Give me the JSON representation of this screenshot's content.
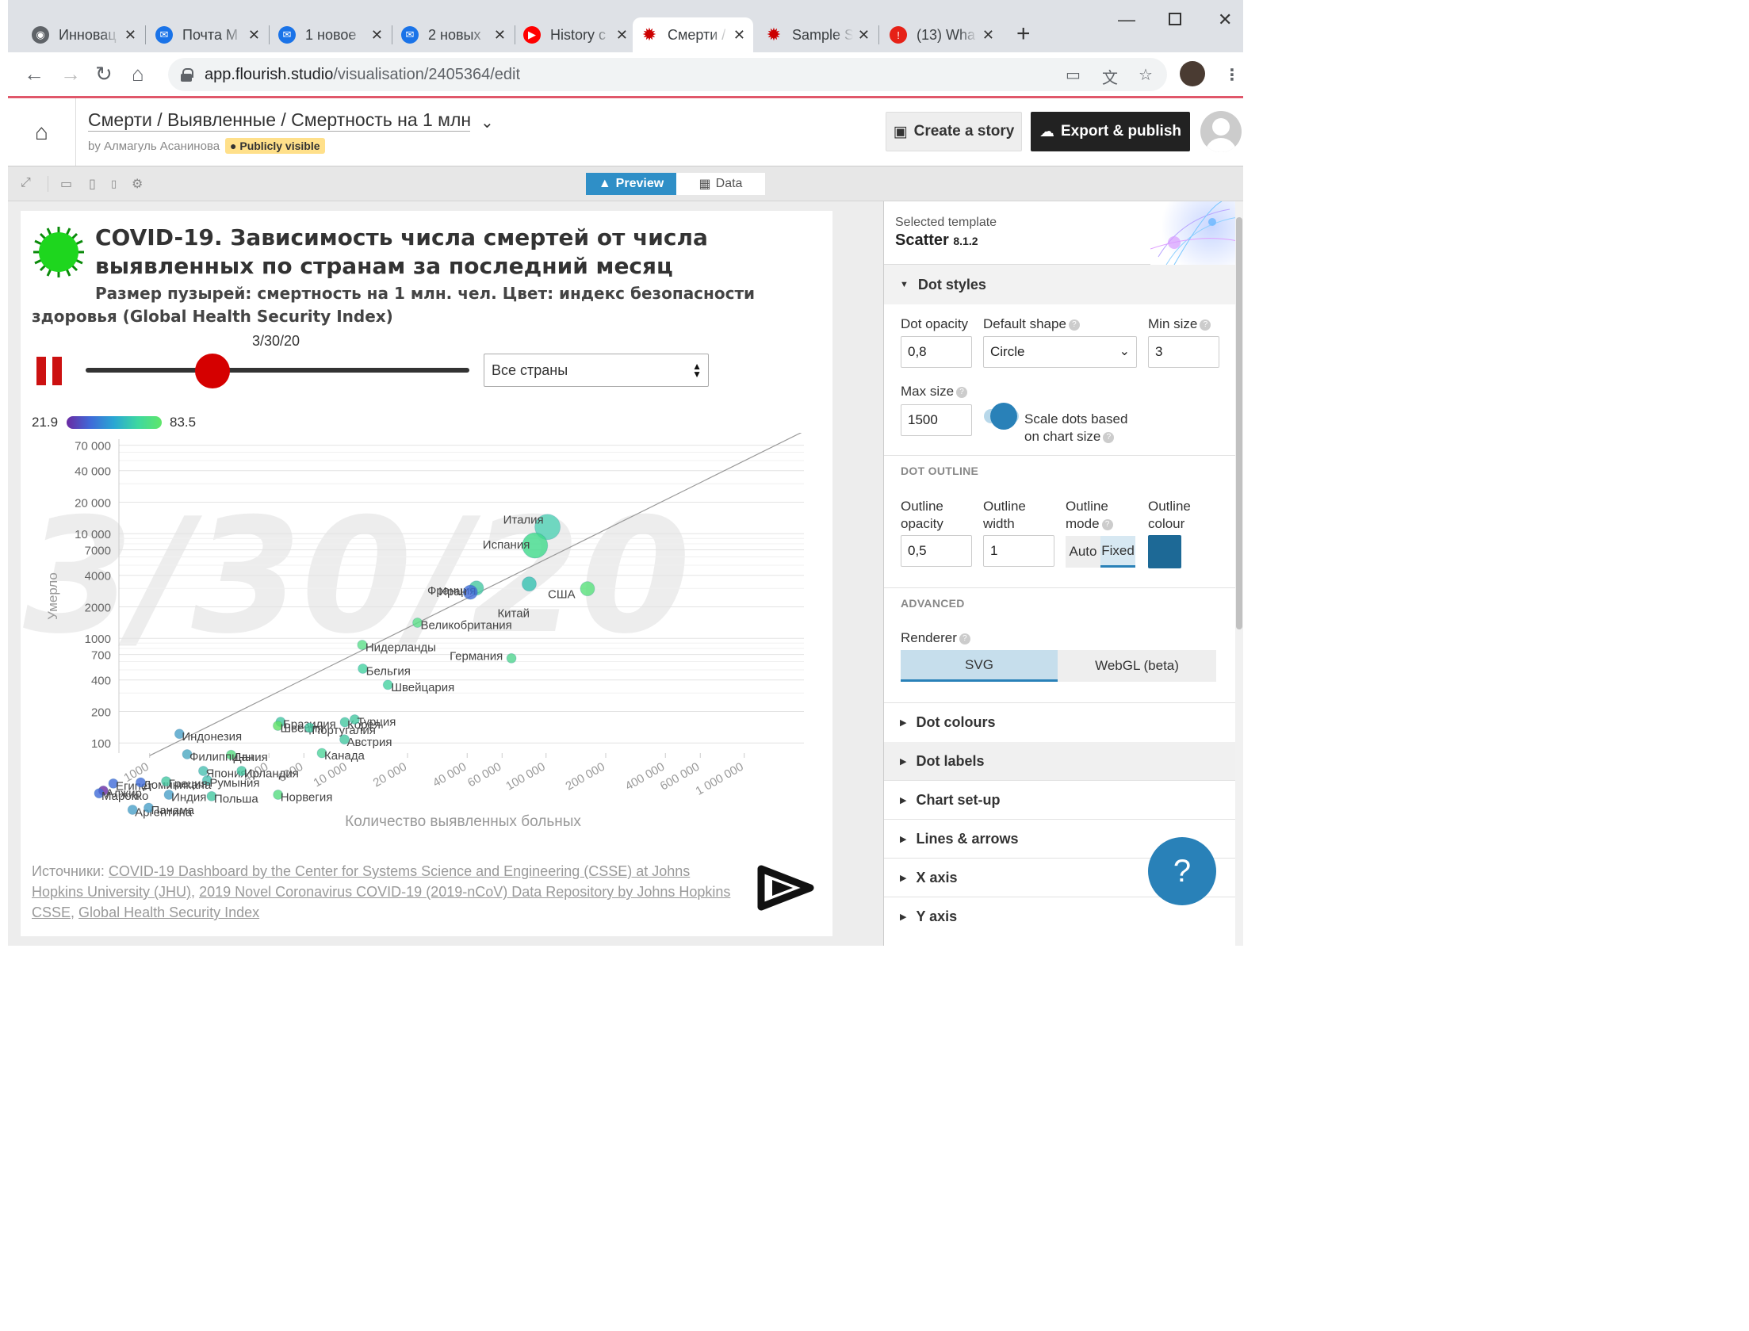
{
  "browser": {
    "tabs": [
      {
        "label": "Инновац",
        "icon": "globe-icon",
        "color": "#5f6368"
      },
      {
        "label": "Почта М",
        "icon": "mail-icon",
        "color": "#1a73e8"
      },
      {
        "label": "1 новое",
        "icon": "mail-icon",
        "color": "#1a73e8"
      },
      {
        "label": "2 новых",
        "icon": "mail-icon",
        "color": "#1a73e8"
      },
      {
        "label": "History c",
        "icon": "youtube-icon",
        "color": "#ff0000"
      },
      {
        "label": "Смерти /",
        "icon": "flourish-virus-icon",
        "color": "#cc0000"
      },
      {
        "label": "Sample S",
        "icon": "flourish-virus-icon",
        "color": "#cc0000"
      },
      {
        "label": "(13) Wha",
        "icon": "alert-icon",
        "color": "#e62117"
      }
    ],
    "active_tab": 5,
    "url_host": "app.flourish.studio",
    "url_path": "/visualisation/2405364/edit"
  },
  "app": {
    "title": "Смерти / Выявленные / Смертность на 1 млн",
    "by": "by Алмагуль Асанинова",
    "visibility": "Publicly visible",
    "create_story": "Create a story",
    "export": "Export & publish",
    "tab_preview": "Preview",
    "tab_data": "Data"
  },
  "viz": {
    "title": "COVID-19. Зависимость числа смертей от числа выявленных по странам за последний месяц",
    "subtitle": "Размер пузырей: смертность на 1 млн. чел. Цвет: индекс безопасности здоровья (Global Health Security Index)",
    "slider_value": "3/30/20",
    "slider_position": 0.33,
    "select_value": "Все страны",
    "legend_min": "21.9",
    "legend_max": "83.5",
    "watermark": "3/30/20",
    "source_prefix": "Источники: ",
    "sources": [
      "COVID-19 Dashboard by the Center for Systems Science and Engineering (CSSE) at Johns Hopkins University (JHU)",
      "2019 Novel Coronavirus COVID-19 (2019-nCoV) Data Repository by Johns Hopkins CSSE",
      "Global Health Security Index"
    ]
  },
  "chart_data": {
    "type": "scatter",
    "xlabel": "Количество выявленных больных",
    "ylabel": "Умерло",
    "x_scale": "log",
    "y_scale": "log",
    "x_ticks": [
      "1000",
      "4000",
      "6000",
      "10 000",
      "20 000",
      "40 000",
      "60 000",
      "100 000",
      "200 000",
      "400 000",
      "600 000",
      "1 000 000"
    ],
    "y_ticks": [
      "100",
      "200",
      "400",
      "700",
      "1000",
      "2000",
      "4000",
      "7000",
      "10 000",
      "20 000",
      "40 000",
      "70 000"
    ],
    "points": [
      {
        "name": "Италия",
        "x": 101739,
        "y": 11591,
        "color": "#4fd1b4"
      },
      {
        "name": "Испания",
        "x": 87956,
        "y": 7716,
        "color": "#3fd98a"
      },
      {
        "name": "Китай",
        "x": 82198,
        "y": 3308,
        "color": "#35c0b0"
      },
      {
        "name": "США",
        "x": 161807,
        "y": 2978,
        "color": "#57e07a"
      },
      {
        "name": "Франция",
        "x": 44550,
        "y": 3024,
        "color": "#46c8a0"
      },
      {
        "name": "Иран",
        "x": 41495,
        "y": 2757,
        "color": "#3f6ad8"
      },
      {
        "name": "Великобритания",
        "x": 22453,
        "y": 1411,
        "color": "#5de08a"
      },
      {
        "name": "Нидерланды",
        "x": 11817,
        "y": 865,
        "color": "#5de08a"
      },
      {
        "name": "Германия",
        "x": 66885,
        "y": 645,
        "color": "#50d48e"
      },
      {
        "name": "Бельгия",
        "x": 11899,
        "y": 513,
        "color": "#45d2a0"
      },
      {
        "name": "Швейцария",
        "x": 15922,
        "y": 359,
        "color": "#45d2a0"
      },
      {
        "name": "Корея",
        "x": 9661,
        "y": 158,
        "color": "#45c8a0"
      },
      {
        "name": "Бразилия",
        "x": 4579,
        "y": 159,
        "color": "#45c8a0"
      },
      {
        "name": "Турция",
        "x": 10827,
        "y": 168,
        "color": "#45c8a0"
      },
      {
        "name": "Швеция",
        "x": 4435,
        "y": 146,
        "color": "#60e066"
      },
      {
        "name": "Португалия",
        "x": 6408,
        "y": 140,
        "color": "#45c8a0"
      },
      {
        "name": "Индонезия",
        "x": 1414,
        "y": 122,
        "color": "#4aa0c8"
      },
      {
        "name": "Австрия",
        "x": 9618,
        "y": 108,
        "color": "#45c8a0"
      },
      {
        "name": "Канада",
        "x": 7398,
        "y": 80,
        "color": "#50d49a"
      },
      {
        "name": "Дания",
        "x": 2577,
        "y": 77,
        "color": "#55dc80"
      },
      {
        "name": "Филиппины",
        "x": 1546,
        "y": 78,
        "color": "#4aa8c0"
      },
      {
        "name": "Япония",
        "x": 1866,
        "y": 54,
        "color": "#4ac0b0"
      },
      {
        "name": "Румыния",
        "x": 1952,
        "y": 44,
        "color": "#4ac0b0"
      },
      {
        "name": "Ирландия",
        "x": 2910,
        "y": 54,
        "color": "#45c8a0"
      },
      {
        "name": "Египет",
        "x": 656,
        "y": 41,
        "color": "#3f6ad8"
      },
      {
        "name": "Доминикана",
        "x": 901,
        "y": 42,
        "color": "#3f6ad8"
      },
      {
        "name": "Греция",
        "x": 1212,
        "y": 43,
        "color": "#45c8a0"
      },
      {
        "name": "Алжир",
        "x": 584,
        "y": 35,
        "color": "#6a2aa3"
      },
      {
        "name": "Марокко",
        "x": 556,
        "y": 33,
        "color": "#3f6ad8"
      },
      {
        "name": "Индия",
        "x": 1251,
        "y": 32,
        "color": "#4aa0c8"
      },
      {
        "name": "Норвегия",
        "x": 4445,
        "y": 32,
        "color": "#55dc80"
      },
      {
        "name": "Польша",
        "x": 2055,
        "y": 31,
        "color": "#45c8a0"
      },
      {
        "name": "Аргентина",
        "x": 820,
        "y": 23,
        "color": "#4aa0c8"
      },
      {
        "name": "Панама",
        "x": 989,
        "y": 24,
        "color": "#4aa0c8"
      }
    ],
    "reference_line": "diagonal",
    "grid": true
  },
  "panel": {
    "template_label": "Selected template",
    "template_name": "Scatter",
    "template_version": "8.1.2",
    "dot_styles": "Dot styles",
    "dot_opacity_label": "Dot opacity",
    "dot_opacity": "0,8",
    "default_shape_label": "Default shape",
    "default_shape": "Circle",
    "min_size_label": "Min size",
    "min_size": "3",
    "max_size_label": "Max size",
    "max_size": "1500",
    "scale_label": "Scale dots based on chart size",
    "scale_on": true,
    "dot_outline": "DOT OUTLINE",
    "outline_opacity_label": "Outline opacity",
    "outline_opacity": "0,5",
    "outline_width_label": "Outline width",
    "outline_width": "1",
    "outline_mode_label": "Outline mode",
    "mode_auto": "Auto",
    "mode_fixed": "Fixed",
    "outline_colour_label": "Outline colour",
    "outline_colour": "#1d6996",
    "advanced": "ADVANCED",
    "renderer_label": "Renderer",
    "renderer_svg": "SVG",
    "renderer_webgl": "WebGL (beta)",
    "sections": [
      "Dot colours",
      "Dot labels",
      "Chart set-up",
      "Lines & arrows",
      "X axis",
      "Y axis"
    ]
  },
  "help_label": "?"
}
